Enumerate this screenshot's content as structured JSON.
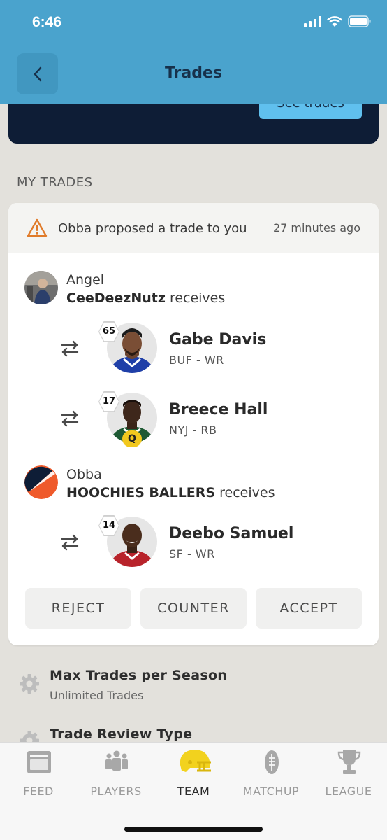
{
  "status_bar": {
    "time": "6:46"
  },
  "header": {
    "title": "Trades"
  },
  "banner": {
    "button_label": "See trades"
  },
  "section_label": "MY TRADES",
  "trade": {
    "proposal_text": "Obba proposed a trade to you",
    "time_ago": "27 minutes ago",
    "parties": [
      {
        "owner": "Angel",
        "team": "CeeDeezNutz",
        "receives_label": "receives",
        "players": [
          {
            "rank": "65",
            "name": "Gabe Davis",
            "position": "BUF - WR"
          },
          {
            "rank": "17",
            "name": "Breece Hall",
            "position": "NYJ - RB",
            "status": "Q"
          }
        ]
      },
      {
        "owner": "Obba",
        "team": "HOOCHIES BALLERS",
        "receives_label": "receives",
        "players": [
          {
            "rank": "14",
            "name": "Deebo Samuel",
            "position": "SF - WR"
          }
        ]
      }
    ],
    "actions": {
      "reject": "REJECT",
      "counter": "COUNTER",
      "accept": "ACCEPT"
    }
  },
  "settings": [
    {
      "title": "Max Trades per Season",
      "subtitle": "Unlimited Trades"
    },
    {
      "title": "Trade Review Type"
    }
  ],
  "tabs": [
    {
      "label": "FEED",
      "icon": "feed-icon"
    },
    {
      "label": "PLAYERS",
      "icon": "players-icon"
    },
    {
      "label": "TEAM",
      "icon": "helmet-icon",
      "active": true
    },
    {
      "label": "MATCHUP",
      "icon": "football-icon"
    },
    {
      "label": "LEAGUE",
      "icon": "trophy-icon"
    }
  ],
  "colors": {
    "header_bg": "#4aa3cd",
    "banner_bg": "#0e1d36",
    "accent_button": "#60c0ee",
    "warning": "#e07b2a",
    "questionable_badge": "#f2c81e",
    "active_tab_icon": "#f2d21e"
  }
}
